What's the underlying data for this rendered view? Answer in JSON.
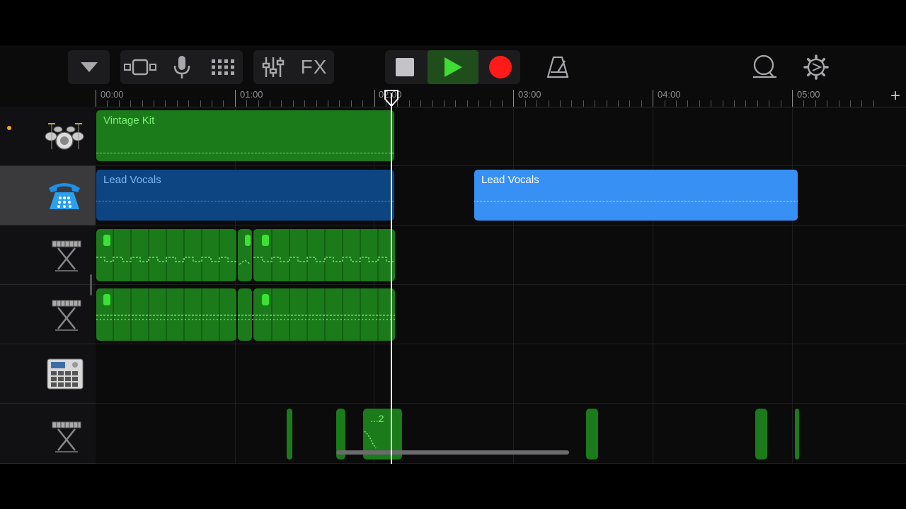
{
  "toolbar": {
    "icons": [
      "chevron-down-icon",
      "view-toggle-icon",
      "microphone-icon",
      "grid-icon",
      "mixer-icon",
      "fx-icon",
      "stop-icon",
      "play-icon",
      "record-icon",
      "metronome-icon",
      "loop-icon",
      "settings-icon"
    ],
    "fx_label": "FX"
  },
  "ruler": {
    "labels": [
      "00:00",
      "01:00",
      "02:00",
      "03:00",
      "04:00",
      "05:00"
    ],
    "add_label": "+"
  },
  "tracks": [
    {
      "instrument": "drum-kit-icon",
      "regions": [
        {
          "label": "Vintage Kit"
        }
      ]
    },
    {
      "instrument": "telephone-icon",
      "selected": true,
      "regions": [
        {
          "label": "Lead Vocals"
        },
        {
          "label": "Lead Vocals"
        }
      ]
    },
    {
      "instrument": "keyboard-icon",
      "regions": []
    },
    {
      "instrument": "keyboard-icon",
      "regions": []
    },
    {
      "instrument": "drum-machine-icon",
      "regions": []
    },
    {
      "instrument": "keyboard-icon",
      "regions": [
        {
          "label": "...2"
        }
      ]
    }
  ],
  "colors": {
    "green_region": "#1b7a1a",
    "green_light": "#2fd32a",
    "blue_dark": "#0d4482",
    "blue_light": "#3790f3",
    "record": "#ff1a1a",
    "play": "#3fdc34"
  }
}
